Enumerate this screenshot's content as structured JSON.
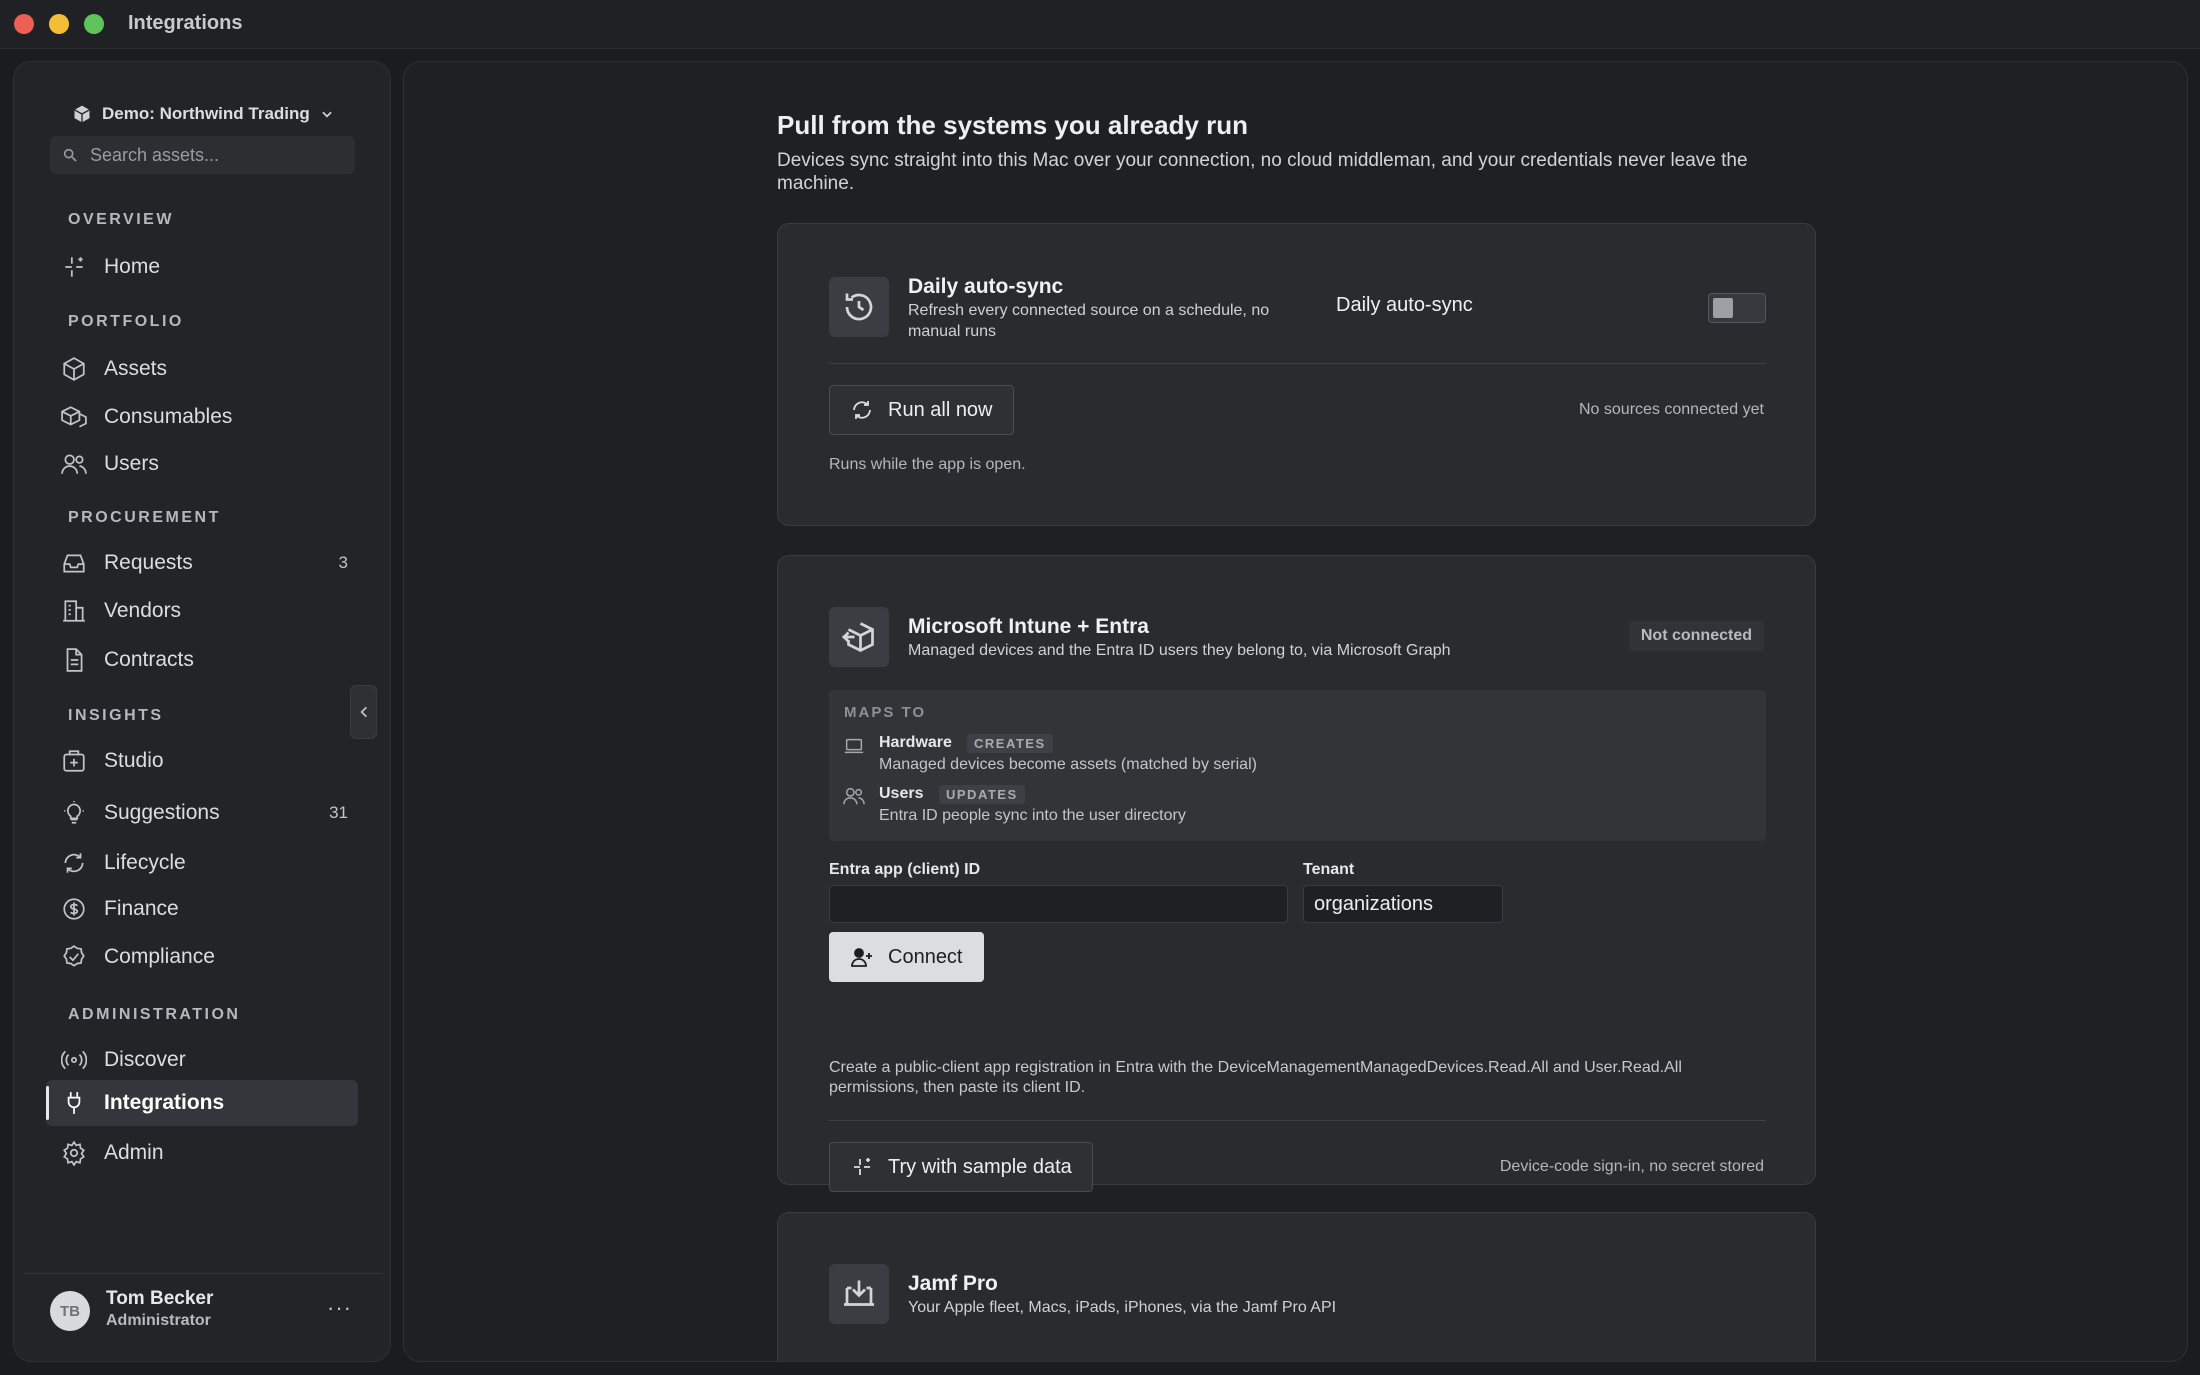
{
  "window": {
    "title": "Integrations"
  },
  "sidebar": {
    "workspace": "Demo: Northwind Trading",
    "search_placeholder": "Search assets...",
    "sections": {
      "overview": "OVERVIEW",
      "portfolio": "PORTFOLIO",
      "procurement": "PROCUREMENT",
      "insights": "INSIGHTS",
      "administration": "ADMINISTRATION"
    },
    "items": {
      "home": {
        "label": "Home",
        "icon": "sparkle-icon"
      },
      "assets": {
        "label": "Assets",
        "icon": "box-icon"
      },
      "consumables": {
        "label": "Consumables",
        "icon": "boxes-icon"
      },
      "users": {
        "label": "Users",
        "icon": "users-icon"
      },
      "requests": {
        "label": "Requests",
        "icon": "inbox-icon",
        "count": "3"
      },
      "vendors": {
        "label": "Vendors",
        "icon": "building-icon"
      },
      "contracts": {
        "label": "Contracts",
        "icon": "document-icon"
      },
      "studio": {
        "label": "Studio",
        "icon": "studio-icon"
      },
      "suggestions": {
        "label": "Suggestions",
        "icon": "lightbulb-icon",
        "count": "31"
      },
      "lifecycle": {
        "label": "Lifecycle",
        "icon": "refresh-icon"
      },
      "finance": {
        "label": "Finance",
        "icon": "dollar-icon"
      },
      "compliance": {
        "label": "Compliance",
        "icon": "badge-check-icon"
      },
      "discover": {
        "label": "Discover",
        "icon": "radar-icon"
      },
      "integrations": {
        "label": "Integrations",
        "icon": "plug-icon"
      },
      "admin": {
        "label": "Admin",
        "icon": "gear-icon"
      }
    },
    "active_item": "integrations",
    "user": {
      "initials": "TB",
      "name": "Tom Becker",
      "role": "Administrator",
      "more": "···"
    }
  },
  "main": {
    "title": "Pull from the systems you already run",
    "subtitle": "Devices sync straight into this Mac over your connection, no cloud middleman, and your credentials never leave the machine.",
    "autosync": {
      "title": "Daily auto-sync",
      "description": "Refresh every connected source on a schedule, no manual runs",
      "toggle_label": "Daily auto-sync",
      "toggle_on": false,
      "run_button": "Run all now",
      "status": "No sources connected yet",
      "note": "Runs while the app is open."
    },
    "intune": {
      "title": "Microsoft Intune + Entra",
      "description": "Managed devices and the Entra ID users they belong to, via Microsoft Graph",
      "status": "Not connected",
      "maps_label": "MAPS TO",
      "maps": [
        {
          "name": "Hardware",
          "tag": "CREATES",
          "desc": "Managed devices become assets (matched by serial)",
          "icon": "laptop-icon"
        },
        {
          "name": "Users",
          "tag": "UPDATES",
          "desc": "Entra ID people sync into the user directory",
          "icon": "users-icon"
        }
      ],
      "client_id_label": "Entra app (client) ID",
      "client_id_value": "",
      "tenant_label": "Tenant",
      "tenant_value": "organizations",
      "connect_button": "Connect",
      "help": "Create a public-client app registration in Entra with the DeviceManagementManagedDevices.Read.All and User.Read.All permissions, then paste its client ID.",
      "sample_button": "Try with sample data",
      "footnote": "Device-code sign-in, no secret stored"
    },
    "jamf": {
      "title": "Jamf Pro",
      "description": "Your Apple fleet, Macs, iPads, iPhones, via the Jamf Pro API"
    }
  }
}
